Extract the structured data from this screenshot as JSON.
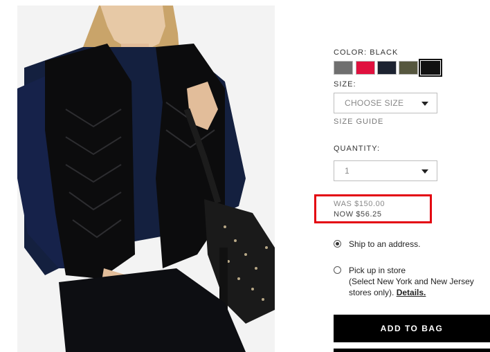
{
  "product": {
    "image_alt": "Model wearing black quilted vest with studded hobo bag"
  },
  "color": {
    "label": "COLOR: BLACK",
    "swatches": [
      {
        "name": "grey",
        "hex": "#6f6f6f"
      },
      {
        "name": "red",
        "hex": "#e0103e"
      },
      {
        "name": "navy",
        "hex": "#1c2230"
      },
      {
        "name": "olive",
        "hex": "#56573f"
      },
      {
        "name": "black",
        "hex": "#111111",
        "selected": true
      }
    ]
  },
  "size": {
    "label": "SIZE:",
    "value": "CHOOSE SIZE",
    "guide": "SIZE GUIDE"
  },
  "quantity": {
    "label": "QUANTITY:",
    "value": "1"
  },
  "price": {
    "was": "WAS $150.00",
    "now": "NOW $56.25",
    "highlight_color": "#e3000f"
  },
  "delivery": {
    "ship_label": "Ship to an address.",
    "pickup_label": "Pick up in store",
    "pickup_note": "(Select New York and New Jersey stores only).",
    "details_link": "Details."
  },
  "actions": {
    "add_to_bag": "ADD TO BAG"
  }
}
